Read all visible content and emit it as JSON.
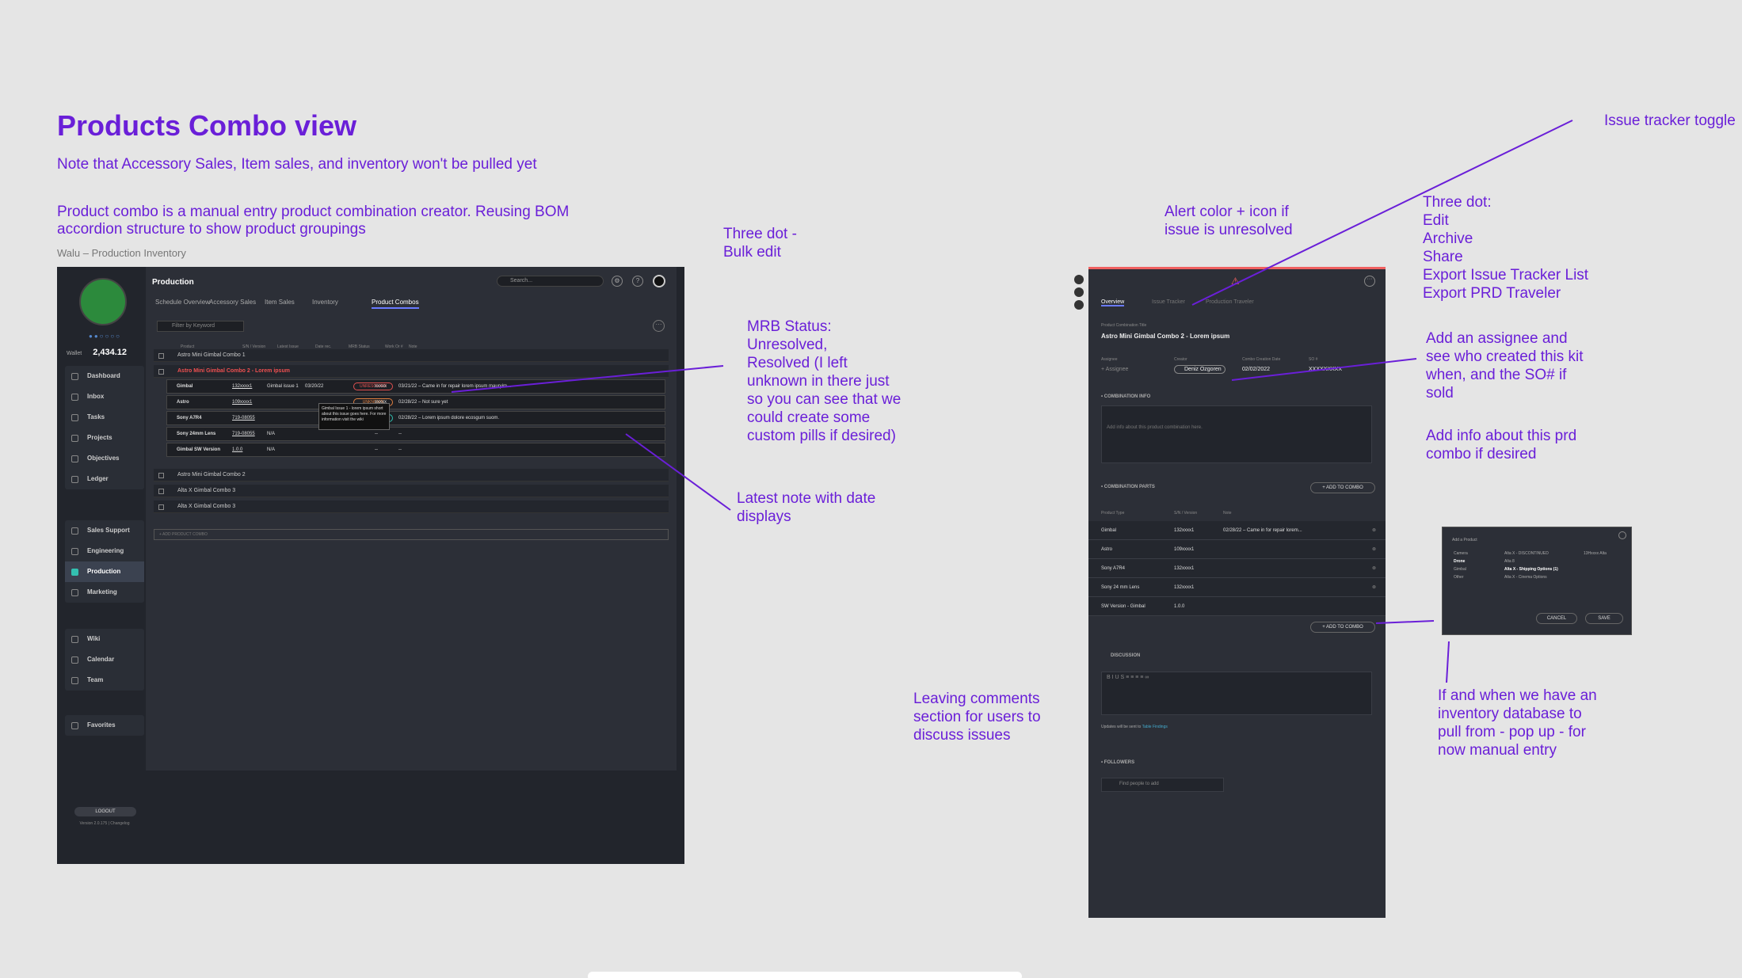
{
  "page": {
    "title": "Products Combo view",
    "note1": "Note that Accessory Sales, Item sales, and inventory won't be pulled yet",
    "note2": "Product combo is a manual entry product combination creator. Reusing BOM accordion structure to show product groupings",
    "breadcrumb": "Walu – Production Inventory"
  },
  "sidebar": {
    "dots": "●●○○○○",
    "wallet_label": "Wallet",
    "wallet_value": "2,434.12",
    "group1": [
      "Dashboard",
      "Inbox",
      "Tasks",
      "Projects",
      "Objectives",
      "Ledger"
    ],
    "group2": [
      "Sales Support",
      "Engineering",
      "Production",
      "Marketing"
    ],
    "group3": [
      "Wiki",
      "Calendar",
      "Team"
    ],
    "favorites": "Favorites",
    "logout": "LOGOUT",
    "version": "Version 2.0.175 | Changelog"
  },
  "main": {
    "title": "Production",
    "search_placeholder": "Search...",
    "tabs": [
      "Schedule Overview",
      "Accessory Sales",
      "Item Sales",
      "Inventory",
      "Product Combos"
    ],
    "filter_placeholder": "Filter by Keyword",
    "headers": [
      "Product",
      "S/N / Version",
      "Latest Issue",
      "Date rec.",
      "MRB Status",
      "Work Or #",
      "Note"
    ],
    "combos_top": [
      "Astro Mini Gimbal Combo 1",
      "Astro Mini Gimbal Combo 2 - Lorem ipsum"
    ],
    "parts": [
      {
        "name": "Gimbal",
        "sn": "132xxxx1",
        "issue": "Gimbal issue 1",
        "date": "03/20/22",
        "status": "UNRESOLVED",
        "wo": "xxxxx",
        "note": "03/21/22 – Came in for repair lorem ipsum mauryim..."
      },
      {
        "name": "Astro",
        "sn": "109xxxx1",
        "issue": "",
        "date": "",
        "status": "UNKNOWN",
        "wo": "xxxxx",
        "note": "02/28/22 – Not sure yet"
      },
      {
        "name": "Sony A7R4",
        "sn": "719-08055",
        "issue": "",
        "date": "",
        "status": "RESOLVED",
        "wo": "xxxxx",
        "note": "02/28/22 – Lorem ipsum dolore ecosgum suom."
      },
      {
        "name": "Sony 24mm Lens",
        "sn": "719-08055",
        "issue": "N/A",
        "date": "",
        "status": "",
        "wo": "--",
        "note": "--"
      },
      {
        "name": "Gimbal SW Version",
        "sn": "1.0.0",
        "issue": "N/A",
        "date": "",
        "status": "",
        "wo": "--",
        "note": "--"
      }
    ],
    "tooltip": "Gimbal Issue 1 - lorem ipsum short about this issue goes here. For more information visit the wiki",
    "combos_bottom": [
      "Astro Mini Gimbal Combo 2",
      "Alta X Gimbal Combo 3",
      "Alta X Gimbal Combo 3"
    ],
    "add_combo": "+ ADD PRODUCT COMBO"
  },
  "detail": {
    "tabs": [
      "Overview",
      "Issue Tracker",
      "Production Traveler"
    ],
    "title_label": "Product Combination Title",
    "title": "Astro Mini Gimbal Combo 2 - Lorem ipsum",
    "assignee_label": "Assignee",
    "assignee": "+ Assignee",
    "creator_label": "Creator",
    "creator": "Deniz Ozgoren",
    "date_label": "Combo Creation Date",
    "date": "02/02/2022",
    "so_label": "SO #",
    "so": "XXXXXXXXX",
    "info_section": "• COMBINATION INFO",
    "info_placeholder": "Add info about this product combination here.",
    "parts_section": "• COMBINATION PARTS",
    "add_to_combo": "+ ADD TO COMBO",
    "parts_headers": [
      "Product Type",
      "S/N / Version",
      "Note"
    ],
    "parts": [
      {
        "type": "Gimbal",
        "sn": "132xxxx1",
        "note": "02/28/22 – Came in for repair lorem..."
      },
      {
        "type": "Astro",
        "sn": "109xxxx1",
        "note": ""
      },
      {
        "type": "Sony A7R4",
        "sn": "132xxxx1",
        "note": ""
      },
      {
        "type": "Sony 24 mm Lens",
        "sn": "132xxxx1",
        "note": ""
      },
      {
        "type": "SW Version - Gimbal",
        "sn": "1.0.0",
        "note": ""
      }
    ],
    "discussion": "DISCUSSION",
    "updates": "Updates will be sent to",
    "updates_link": "Table Findings",
    "followers": "• FOLLOWERS",
    "find_people": "Find people to add"
  },
  "popup": {
    "title": "Add a Product",
    "col1": [
      "Camera",
      "Drone",
      "Gimbal",
      "Other"
    ],
    "col2": [
      "Alta X - DISCONTINUED",
      "Alta 8",
      "Alta X - Shipping Options (1)",
      "Alta X - Cinema Options"
    ],
    "col3": "13Hxxxx Alta",
    "cancel": "CANCEL",
    "save": "SAVE"
  },
  "annotations": {
    "three_dot": "Three dot -\nBulk edit",
    "mrb": "MRB Status:\nUnresolved,\nResolved (I left\nunknown in there just\nso you can see that we\ncould create some\ncustom pills if desired)",
    "latest_note": "Latest note with date\ndisplays",
    "comments": "Leaving comments\nsection for users to\ndiscuss issues",
    "alert": "Alert color + icon if\nissue is unresolved",
    "issue_toggle": "Issue tracker toggle",
    "three_dot_r": "Three dot:\nEdit\nArchive\nShare\nExport Issue Tracker List\nExport PRD Traveler",
    "assignee": "Add an assignee and\nsee who created this kit\nwhen, and the SO# if\nsold",
    "add_info": "Add info about this prd\ncombo if desired",
    "inventory": "If and when we have an\ninventory database to\npull from - pop up - for\nnow manual entry"
  }
}
